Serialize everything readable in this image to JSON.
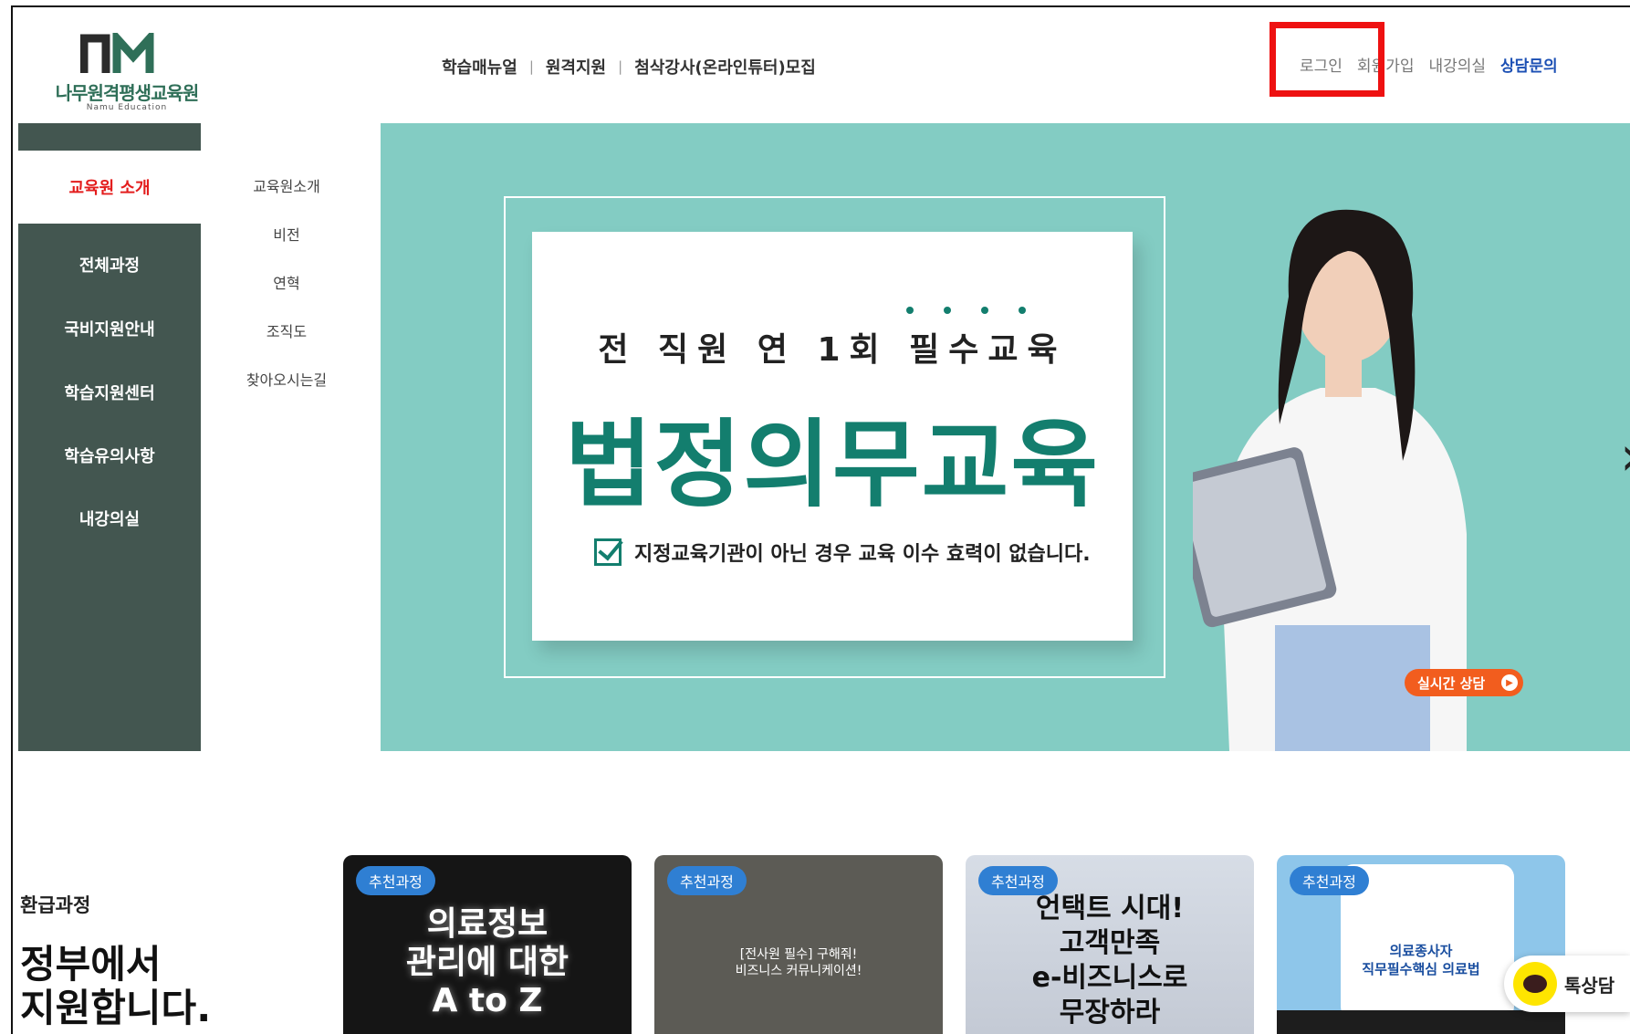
{
  "logo": {
    "name": "나무원격평생교육원",
    "sub": "Namu Education"
  },
  "gnb": {
    "items": [
      "학습매뉴얼",
      "원격지원",
      "첨삭강사(온라인튜터)모집"
    ]
  },
  "util": {
    "login": "로그인",
    "join": "회원가입",
    "classroom": "내강의실",
    "consult": "상담문의"
  },
  "side": {
    "active": "교육원 소개",
    "items": [
      "전체과정",
      "국비지원안내",
      "학습지원센터",
      "학습유의사항",
      "내강의실"
    ]
  },
  "submenu": [
    "교육원소개",
    "비전",
    "연혁",
    "조직도",
    "찾아오시는길"
  ],
  "hero": {
    "tagline": "전 직원 연 1회 필수교육",
    "title": "법정의무교육",
    "notice": "지정교육기관이 아닌 경우 교육 이수 효력이 없습니다.",
    "live_consult": "실시간 상담"
  },
  "refund": {
    "label": "환급과정",
    "title_line1": "정부에서",
    "title_line2": "지원합니다."
  },
  "cards": [
    {
      "badge": "추천과정",
      "line1": "의료정보",
      "line2": "관리에 대한",
      "line3": "A to Z"
    },
    {
      "badge": "추천과정",
      "line1": "[전사원 필수] 구해줘!",
      "line2": "비즈니스 커뮤니케이션!"
    },
    {
      "badge": "추천과정",
      "line1": "언택트 시대!",
      "line2": "고객만족",
      "line3": "e-비즈니스로",
      "line4": "무장하라"
    },
    {
      "badge": "추천과정",
      "line1": "의료종사자",
      "line2": "직무필수핵심 의료법"
    }
  ],
  "kakao": {
    "label": "톡상담"
  },
  "colors": {
    "hero_bg": "#83ccc3",
    "brand_green": "#137e6e",
    "side_bg": "#435650",
    "active_red": "#e31d1d",
    "highlight": "#ee1111"
  }
}
